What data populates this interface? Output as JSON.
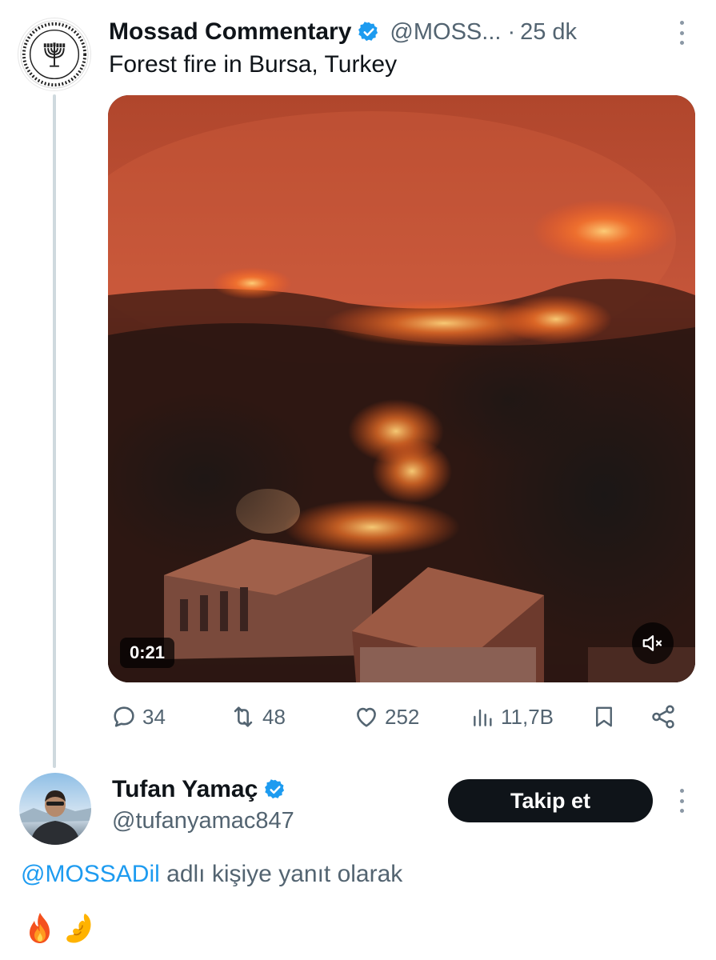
{
  "original_tweet": {
    "display_name": "Mossad Commentary",
    "handle": "@MOSS...",
    "separator": "·",
    "time": "25 dk",
    "text": "Forest fire in Bursa, Turkey",
    "video": {
      "duration": "0:21",
      "muted": true
    },
    "actions": {
      "replies": "34",
      "reposts": "48",
      "likes": "252",
      "views": "11,7B"
    },
    "icons": [
      "verified-badge-icon",
      "more-icon",
      "reply-icon",
      "repost-icon",
      "like-icon",
      "views-icon",
      "bookmark-icon",
      "share-icon",
      "mute-icon"
    ]
  },
  "reply_tweet": {
    "display_name": "Tufan Yamaç",
    "handle": "@tufanyamac847",
    "follow_label": "Takip et",
    "reply_to_mention": "@MOSSADil",
    "reply_to_suffix": " adlı kişiye yanıt olarak",
    "emojis": [
      "fire-emoji",
      "pinched-fingers-emoji"
    ]
  },
  "colors": {
    "text": "#0f1419",
    "secondary": "#536471",
    "link": "#1d9bf0",
    "verified": "#1d9bf0",
    "thread_line": "#cfd9de",
    "button_bg": "#0f1419"
  }
}
